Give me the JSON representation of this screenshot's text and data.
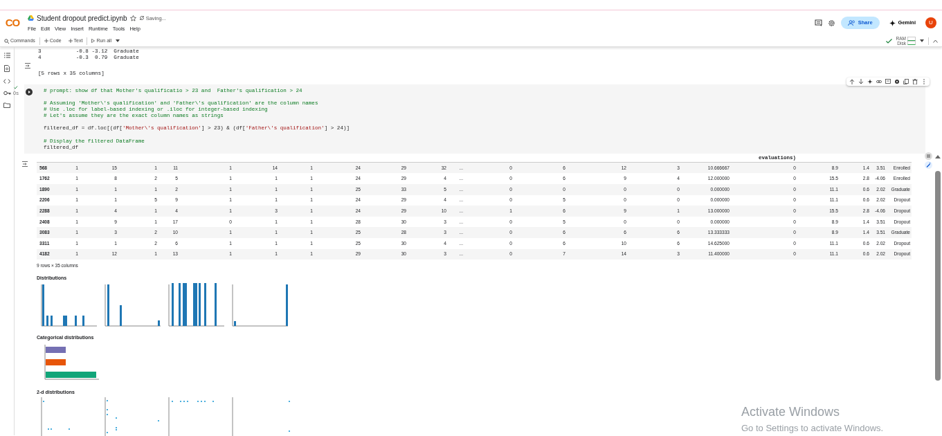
{
  "app": {
    "logo": "CO",
    "title": "Student dropout predict.ipynb",
    "starred": false,
    "save_status": "Saving...",
    "menu": [
      "File",
      "Edit",
      "View",
      "Insert",
      "Runtime",
      "Tools",
      "Help"
    ],
    "share": "Share",
    "gemini": "Gemini",
    "avatar": "U"
  },
  "toolbar": {
    "commands": "Commands",
    "add_code": "Code",
    "add_text": "Text",
    "run_all": "Run all",
    "connected": true,
    "ram": "RAM",
    "disk": "Disk"
  },
  "previous_output": {
    "lines": [
      "3           -0.8 -3.12  Graduate",
      "4           -0.3  0.79  Graduate"
    ],
    "summary": "[5 rows x 35 columns]"
  },
  "code_cell": {
    "run_succeeded": true,
    "run_time": "0s",
    "blocks": [
      [
        [
          {
            "kind": "comment",
            "text": "# prompt: show df that Mother's qualificatio > 23 and  Father's qualification > 24"
          }
        ]
      ],
      [
        [
          {
            "kind": "comment",
            "text": "# Assuming 'Mother\\'s qualification' and 'Father\\'s qualification' are the column names"
          }
        ],
        [
          {
            "kind": "comment",
            "text": "# Use .loc for label-based indexing or .iloc for integer-based indexing"
          }
        ],
        [
          {
            "kind": "comment",
            "text": "# Let's assume they are the exact column names as strings"
          }
        ]
      ],
      [
        [
          {
            "kind": "code",
            "text": "filtered_df = df.loc[(df["
          },
          {
            "kind": "string",
            "text": "'Mother\\'s qualification'"
          },
          {
            "kind": "code",
            "text": "] > 23) & (df["
          },
          {
            "kind": "string",
            "text": "'Father\\'s qualification'"
          },
          {
            "kind": "code",
            "text": "] > 24)]"
          }
        ]
      ],
      [
        [
          {
            "kind": "comment",
            "text": "# Display the filtered DataFrame"
          }
        ],
        [
          {
            "kind": "code",
            "text": "filtered_df"
          }
        ]
      ]
    ]
  },
  "table": {
    "cut_header_text": "evaluations)",
    "rows": [
      [
        "568",
        "1",
        "15",
        "1",
        "11",
        "1",
        "14",
        "1",
        "24",
        "29",
        "32",
        "...",
        "0",
        "6",
        "12",
        "3",
        "10.666667",
        "0",
        "8.9",
        "1.4",
        "3.51",
        "Enrolled"
      ],
      [
        "1762",
        "1",
        "8",
        "2",
        "5",
        "1",
        "1",
        "1",
        "24",
        "29",
        "4",
        "...",
        "0",
        "6",
        "9",
        "4",
        "12.000000",
        "0",
        "15.5",
        "2.8",
        "-4.06",
        "Enrolled"
      ],
      [
        "1890",
        "1",
        "1",
        "1",
        "2",
        "1",
        "1",
        "1",
        "25",
        "33",
        "5",
        "...",
        "0",
        "0",
        "0",
        "0",
        "0.000000",
        "0",
        "11.1",
        "0.6",
        "2.02",
        "Graduate"
      ],
      [
        "2206",
        "1",
        "1",
        "5",
        "9",
        "1",
        "1",
        "1",
        "24",
        "29",
        "4",
        "...",
        "0",
        "5",
        "0",
        "0",
        "0.000000",
        "0",
        "11.1",
        "0.6",
        "2.02",
        "Dropout"
      ],
      [
        "2288",
        "1",
        "4",
        "1",
        "4",
        "1",
        "3",
        "1",
        "24",
        "29",
        "10",
        "...",
        "1",
        "6",
        "9",
        "1",
        "13.000000",
        "0",
        "15.5",
        "2.8",
        "-4.06",
        "Dropout"
      ],
      [
        "2408",
        "1",
        "9",
        "1",
        "17",
        "0",
        "1",
        "1",
        "28",
        "30",
        "3",
        "...",
        "0",
        "5",
        "0",
        "0",
        "0.000000",
        "0",
        "8.9",
        "1.4",
        "3.51",
        "Dropout"
      ],
      [
        "3083",
        "1",
        "3",
        "2",
        "10",
        "1",
        "1",
        "1",
        "25",
        "28",
        "3",
        "...",
        "0",
        "6",
        "6",
        "6",
        "13.333333",
        "0",
        "8.9",
        "1.4",
        "3.51",
        "Graduate"
      ],
      [
        "3311",
        "1",
        "1",
        "2",
        "6",
        "1",
        "1",
        "1",
        "25",
        "30",
        "4",
        "...",
        "0",
        "6",
        "10",
        "6",
        "14.625000",
        "0",
        "11.1",
        "0.6",
        "2.02",
        "Dropout"
      ],
      [
        "4182",
        "1",
        "12",
        "1",
        "13",
        "1",
        "1",
        "1",
        "29",
        "30",
        "3",
        "...",
        "0",
        "7",
        "14",
        "3",
        "11.400000",
        "0",
        "11.1",
        "0.6",
        "2.02",
        "Dropout"
      ]
    ],
    "shape": "9 rows × 35 columns"
  },
  "sections": [
    "Distributions",
    "Categorical distributions",
    "2-d distributions"
  ],
  "os_notice": {
    "title": "Activate Windows",
    "text": "Go to Settings to activate Windows."
  }
}
